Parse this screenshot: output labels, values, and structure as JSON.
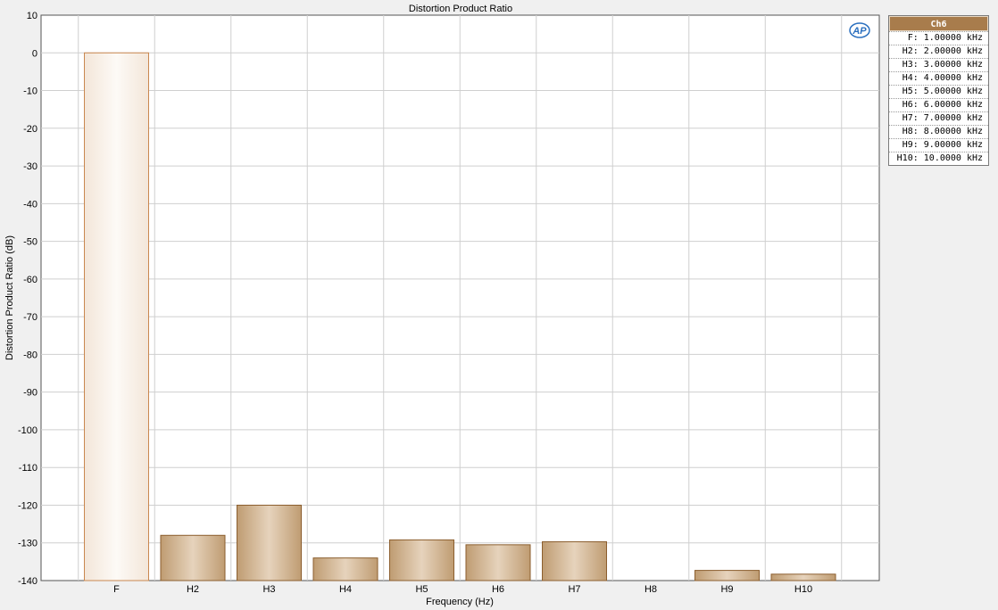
{
  "chart_data": {
    "type": "bar",
    "title": "Distortion Product Ratio",
    "xlabel": "Frequency (Hz)",
    "ylabel": "Distortion Product Ratio (dB)",
    "ylim": [
      -140,
      10
    ],
    "yticks": [
      10,
      0,
      -10,
      -20,
      -30,
      -40,
      -50,
      -60,
      -70,
      -80,
      -90,
      -100,
      -110,
      -120,
      -130,
      -140
    ],
    "grid": true,
    "categories": [
      "F",
      "H2",
      "H3",
      "H4",
      "H5",
      "H6",
      "H7",
      "H8",
      "H9",
      "H10"
    ],
    "series": [
      {
        "name": "Ch6",
        "values": [
          0,
          -128,
          -120,
          -134,
          -129.2,
          -130.5,
          -129.7,
          null,
          -137.3,
          -138.3
        ]
      }
    ],
    "colors": {
      "bar": "#c6a57e",
      "bar_highlight": "#e8d6c0",
      "bar_border": "#8b5e2e",
      "fundamental_fill": "#f9f1ea",
      "fundamental_border": "#c9874f",
      "grid": "#cfcfcf",
      "plot_bg": "#ffffff"
    }
  },
  "legend": {
    "header": "Ch6",
    "entries": [
      "F: 1.00000 kHz",
      "H2: 2.00000 kHz",
      "H3: 3.00000 kHz",
      "H4: 4.00000 kHz",
      "H5: 5.00000 kHz",
      "H6: 6.00000 kHz",
      "H7: 7.00000 kHz",
      "H8: 8.00000 kHz",
      "H9: 9.00000 kHz",
      "H10: 10.0000 kHz"
    ]
  },
  "logo": {
    "text": "AP",
    "icon": "ap-logo-icon",
    "color": "#2a6fbf"
  }
}
